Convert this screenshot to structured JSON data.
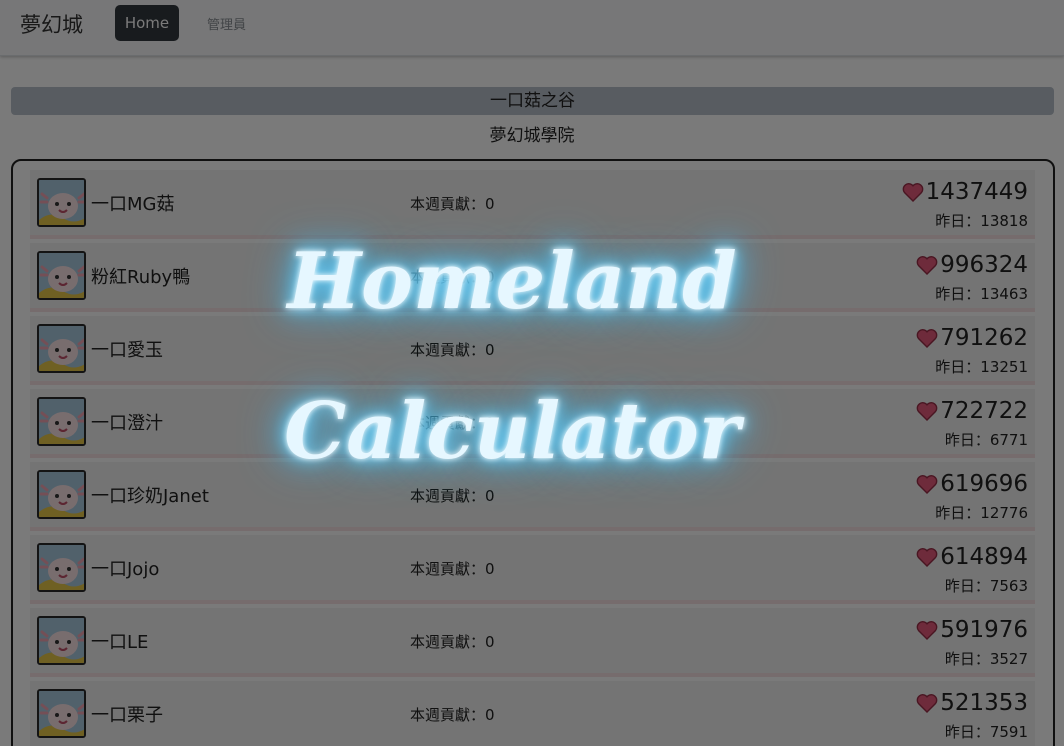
{
  "nav": {
    "brand": "夢幻城",
    "home_label": "Home",
    "admin_label": "管理員"
  },
  "guild": {
    "name": "一口菇之谷",
    "academy": "夢幻城學院"
  },
  "members": [
    {
      "name": "一口MG菇",
      "weekly": "本週貢獻：0",
      "score": "1437449",
      "yesterday": "昨日：13818"
    },
    {
      "name": "粉紅Ruby鴨",
      "weekly": "本週貢獻：0",
      "score": "996324",
      "yesterday": "昨日：13463"
    },
    {
      "name": "一口愛玉",
      "weekly": "本週貢獻：0",
      "score": "791262",
      "yesterday": "昨日：13251"
    },
    {
      "name": "一口澄汁",
      "weekly": "本週貢獻：0",
      "score": "722722",
      "yesterday": "昨日：6771"
    },
    {
      "name": "一口珍奶Janet",
      "weekly": "本週貢獻：0",
      "score": "619696",
      "yesterday": "昨日：12776"
    },
    {
      "name": "一口Jojo",
      "weekly": "本週貢獻：0",
      "score": "614894",
      "yesterday": "昨日：7563"
    },
    {
      "name": "一口LE",
      "weekly": "本週貢獻：0",
      "score": "591976",
      "yesterday": "昨日：3527"
    },
    {
      "name": "一口栗子",
      "weekly": "本週貢獻：0",
      "score": "521353",
      "yesterday": "昨日：7591"
    }
  ],
  "overlay": {
    "line1": "Homeland",
    "line2": "Calculator"
  },
  "colors": {
    "navbar": "#f8f9fa",
    "active_nav": "#343a40",
    "guild_bar": "#b9c1cb",
    "heart": "#e75a7c",
    "neon_glow": "#4ec9ff"
  },
  "icons": {
    "heart": "heart-icon",
    "avatar": "axolotl-avatar"
  }
}
